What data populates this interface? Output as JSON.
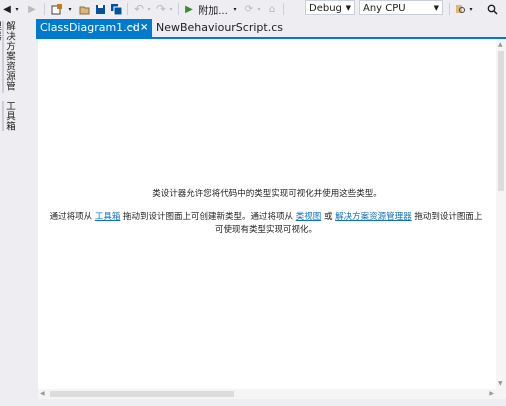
{
  "toolbar": {
    "attach_label": "附加...",
    "config": "Debug",
    "platform": "Any CPU"
  },
  "dock": {
    "solution_explorer": "解决方案资源管理器",
    "toolbox": "工具箱"
  },
  "tabs": {
    "active": "ClassDiagram1.cd",
    "inactive": "NewBehaviourScript.cs"
  },
  "doc": {
    "line1": "类设计器允许您将代码中的类型实现可视化并使用这些类型。",
    "p_a": "通过将项从 ",
    "link_toolbox": "工具箱",
    "p_b": " 拖动到设计图面上可创建新类型。通过将项从 ",
    "link_classview": "类视图",
    "p_c": " 或 ",
    "link_solution": "解决方案资源管理器",
    "p_d": " 拖动到设计图面上可使现有类型实现可视化。"
  },
  "colors": {
    "accent": "#007acc",
    "link": "#0e70c0",
    "chrome": "#eeeef2"
  }
}
